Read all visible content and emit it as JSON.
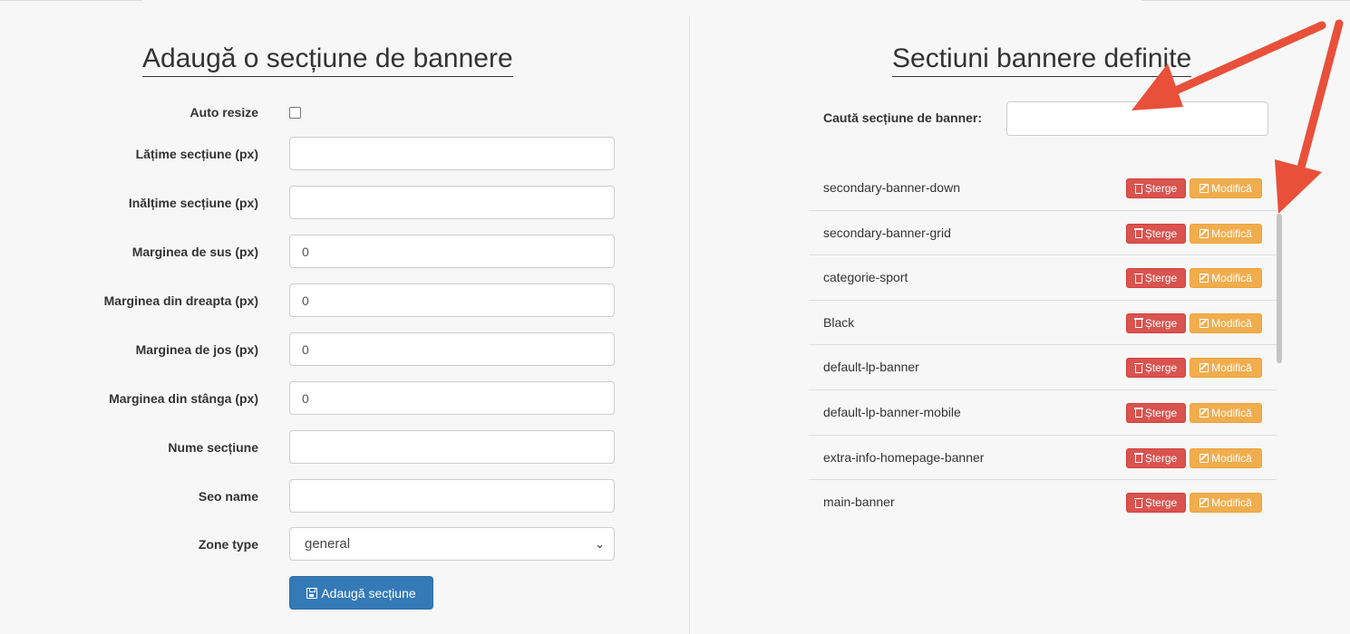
{
  "form": {
    "title": "Adaugă o secțiune de bannere",
    "auto_resize_label": "Auto resize",
    "fields": [
      {
        "label": "Lățime secțiune (px)",
        "value": ""
      },
      {
        "label": "Inălțime secțiune (px)",
        "value": ""
      },
      {
        "label": "Marginea de sus (px)",
        "value": "0"
      },
      {
        "label": "Marginea din dreapta (px)",
        "value": "0"
      },
      {
        "label": "Marginea de jos (px)",
        "value": "0"
      },
      {
        "label": "Marginea din stânga (px)",
        "value": "0"
      },
      {
        "label": "Nume secțiune",
        "value": ""
      },
      {
        "label": "Seo name",
        "value": ""
      }
    ],
    "zone_type_label": "Zone type",
    "zone_type_value": "general",
    "submit_label": "Adaugă secțiune"
  },
  "list_panel": {
    "title": "Sectiuni bannere definite",
    "search_label": "Caută secțiune de banner:",
    "search_value": "",
    "delete_label": "Șterge",
    "edit_label": "Modifică",
    "items": [
      {
        "name": "secondary-banner-down"
      },
      {
        "name": "secondary-banner-grid"
      },
      {
        "name": "categorie-sport"
      },
      {
        "name": "Black"
      },
      {
        "name": "default-lp-banner"
      },
      {
        "name": "default-lp-banner-mobile"
      },
      {
        "name": "extra-info-homepage-banner"
      },
      {
        "name": "main-banner"
      }
    ]
  },
  "colors": {
    "primary": "#337ab7",
    "danger": "#d9534f",
    "warning": "#f0ad4e",
    "annotation_arrow": "#e8503a"
  }
}
